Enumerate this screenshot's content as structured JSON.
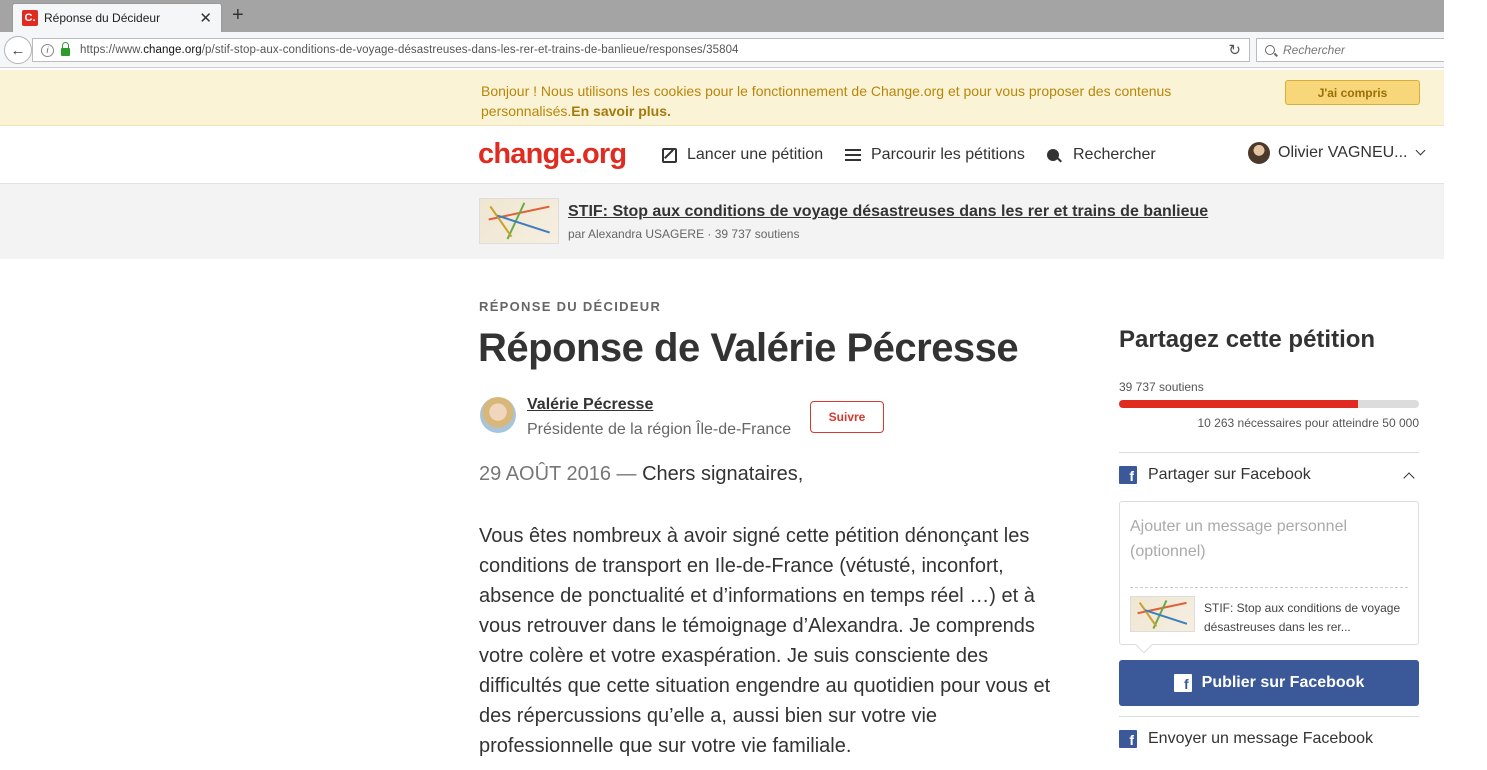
{
  "browser": {
    "tab_title": "Réponse du Décideur",
    "favicon_letter": "C.",
    "url_prefix": "https://www.",
    "url_domain": "change.org",
    "url_path": "/p/stif-stop-aux-conditions-de-voyage-désastreuses-dans-les-rer-et-trains-de-banlieue/responses/35804",
    "search_placeholder": "Rechercher"
  },
  "cookie_banner": {
    "text": "Bonjour ! Nous utilisons les cookies pour le fonctionnement de Change.org et pour vous proposer des contenus personnalisés.",
    "link": "En savoir plus.",
    "button": "J'ai compris"
  },
  "header": {
    "logo": "change.org",
    "nav": [
      "Lancer une pétition",
      "Parcourir les pétitions",
      "Rechercher"
    ],
    "user_name": "Olivier VAGNEU..."
  },
  "petition": {
    "title": "STIF: Stop aux conditions de voyage désastreuses dans les rer et trains de banlieue",
    "byline": "par Alexandra USAGERE · 39 737 soutiens"
  },
  "response": {
    "eyebrow": "RÉPONSE DU DÉCIDEUR",
    "title": "Réponse de Valérie Pécresse",
    "author_name": "Valérie Pécresse",
    "author_role": "Présidente de la région Île-de-France",
    "follow_label": "Suivre",
    "date": "29 AOÛT 2016",
    "dash": " — ",
    "greeting": "Chers signataires,",
    "body": "Vous êtes nombreux à avoir signé cette pétition dénonçant les conditions de transport en Ile-de-France (vétusté, inconfort, absence de ponctualité et d’informations en temps réel …) et à vous retrouver dans le témoignage d’Alexandra. Je comprends votre colère et votre exaspération. Je suis consciente des difficultés que cette situation engendre au quotidien pour vous et des répercussions qu’elle a, aussi bien sur votre vie professionnelle que sur votre vie familiale."
  },
  "sidebar": {
    "title": "Partagez cette pétition",
    "supporters": "39 737 soutiens",
    "progress_fraction": 0.795,
    "needed": "10 263 nécessaires pour atteindre 50 000",
    "share_facebook": "Partager sur Facebook",
    "message_placeholder": "Ajouter un message personnel (optionnel)",
    "preview_caption": "STIF: Stop aux conditions de voyage désastreuses dans les rer...",
    "publish_button": "Publier sur Facebook",
    "send_message": "Envoyer un message Facebook"
  },
  "colors": {
    "brand_red": "#e02b20",
    "facebook_blue": "#3b5998",
    "cookie_bg": "#fbf3d5"
  }
}
